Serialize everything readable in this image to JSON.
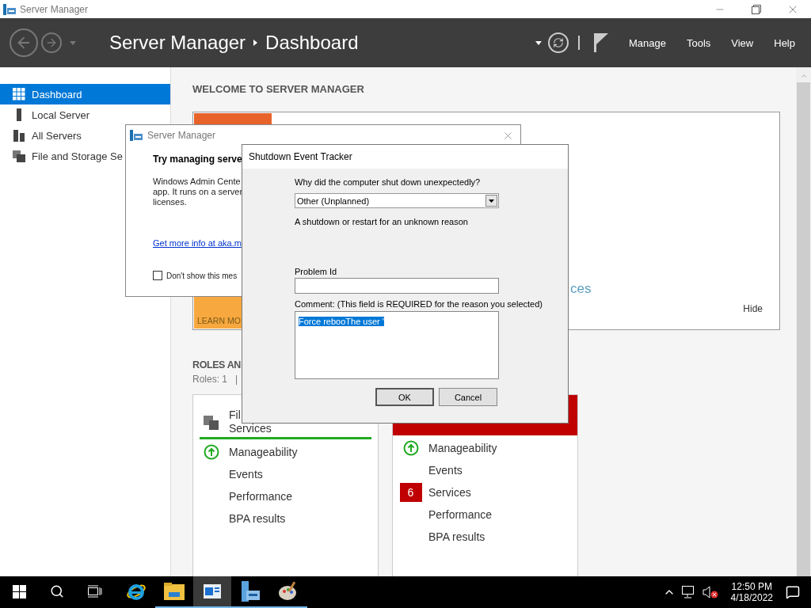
{
  "window": {
    "title": "Server Manager"
  },
  "header": {
    "breadcrumb": [
      "Server Manager",
      "Dashboard"
    ],
    "menu": [
      "Manage",
      "Tools",
      "View",
      "Help"
    ]
  },
  "sidebar": {
    "items": [
      {
        "label": "Dashboard",
        "kind": "dashboard",
        "selected": true
      },
      {
        "label": "Local Server",
        "kind": "server",
        "selected": false
      },
      {
        "label": "All Servers",
        "kind": "servers",
        "selected": false
      },
      {
        "label": "File and Storage Se",
        "kind": "storage",
        "selected": false
      }
    ]
  },
  "welcome": {
    "title": "WELCOME TO SERVER MANAGER",
    "learn_more": "LEARN MO",
    "link_fragment": "ces",
    "hide": "Hide"
  },
  "roles": {
    "title": "ROLES AN",
    "summary": "Roles: 1   |",
    "cards": [
      {
        "title": "Fil\nServices",
        "alert": false,
        "items": [
          {
            "label": "Manageability",
            "kind": "ok"
          },
          {
            "label": "Events",
            "kind": "plain"
          },
          {
            "label": "Performance",
            "kind": "plain"
          },
          {
            "label": "BPA results",
            "kind": "plain"
          }
        ]
      },
      {
        "alert": true,
        "items": [
          {
            "label": "Manageability",
            "kind": "ok"
          },
          {
            "label": "Events",
            "kind": "plain"
          },
          {
            "label": "Services",
            "kind": "count",
            "count": "6"
          },
          {
            "label": "Performance",
            "kind": "plain"
          },
          {
            "label": "BPA results",
            "kind": "plain"
          }
        ]
      }
    ]
  },
  "popup": {
    "title": "Server Manager",
    "heading": "Try managing serve",
    "body": "Windows Admin Cente\napp. It runs on a server\nlicenses.",
    "link": "Get more info at aka.m",
    "checkbox": {
      "label": "Don't show this mes",
      "checked": false
    }
  },
  "shutdown": {
    "title": "Shutdown Event Tracker",
    "question": "Why did the computer shut down unexpectedly?",
    "reason": "Other (Unplanned)",
    "description": "A shutdown or restart for an unknown reason",
    "problem_id_label": "Problem Id",
    "comment_label": "Comment: (This field is REQUIRED for the reason you selected)",
    "comment": "Force rebooThe user '",
    "comment_selected": true,
    "buttons": [
      {
        "label": "OK",
        "default": true
      },
      {
        "label": "Cancel",
        "default": false
      }
    ]
  },
  "taskbar": {
    "apps": [
      {
        "kind": "ie",
        "running": false,
        "selected": false
      },
      {
        "kind": "explorer",
        "running": true,
        "selected": false
      },
      {
        "kind": "dashboard",
        "running": true,
        "selected": true
      },
      {
        "kind": "server",
        "running": true,
        "selected": false
      },
      {
        "kind": "paint",
        "running": true,
        "selected": false
      }
    ],
    "time": "12:50 PM",
    "date": "4/18/2022"
  }
}
